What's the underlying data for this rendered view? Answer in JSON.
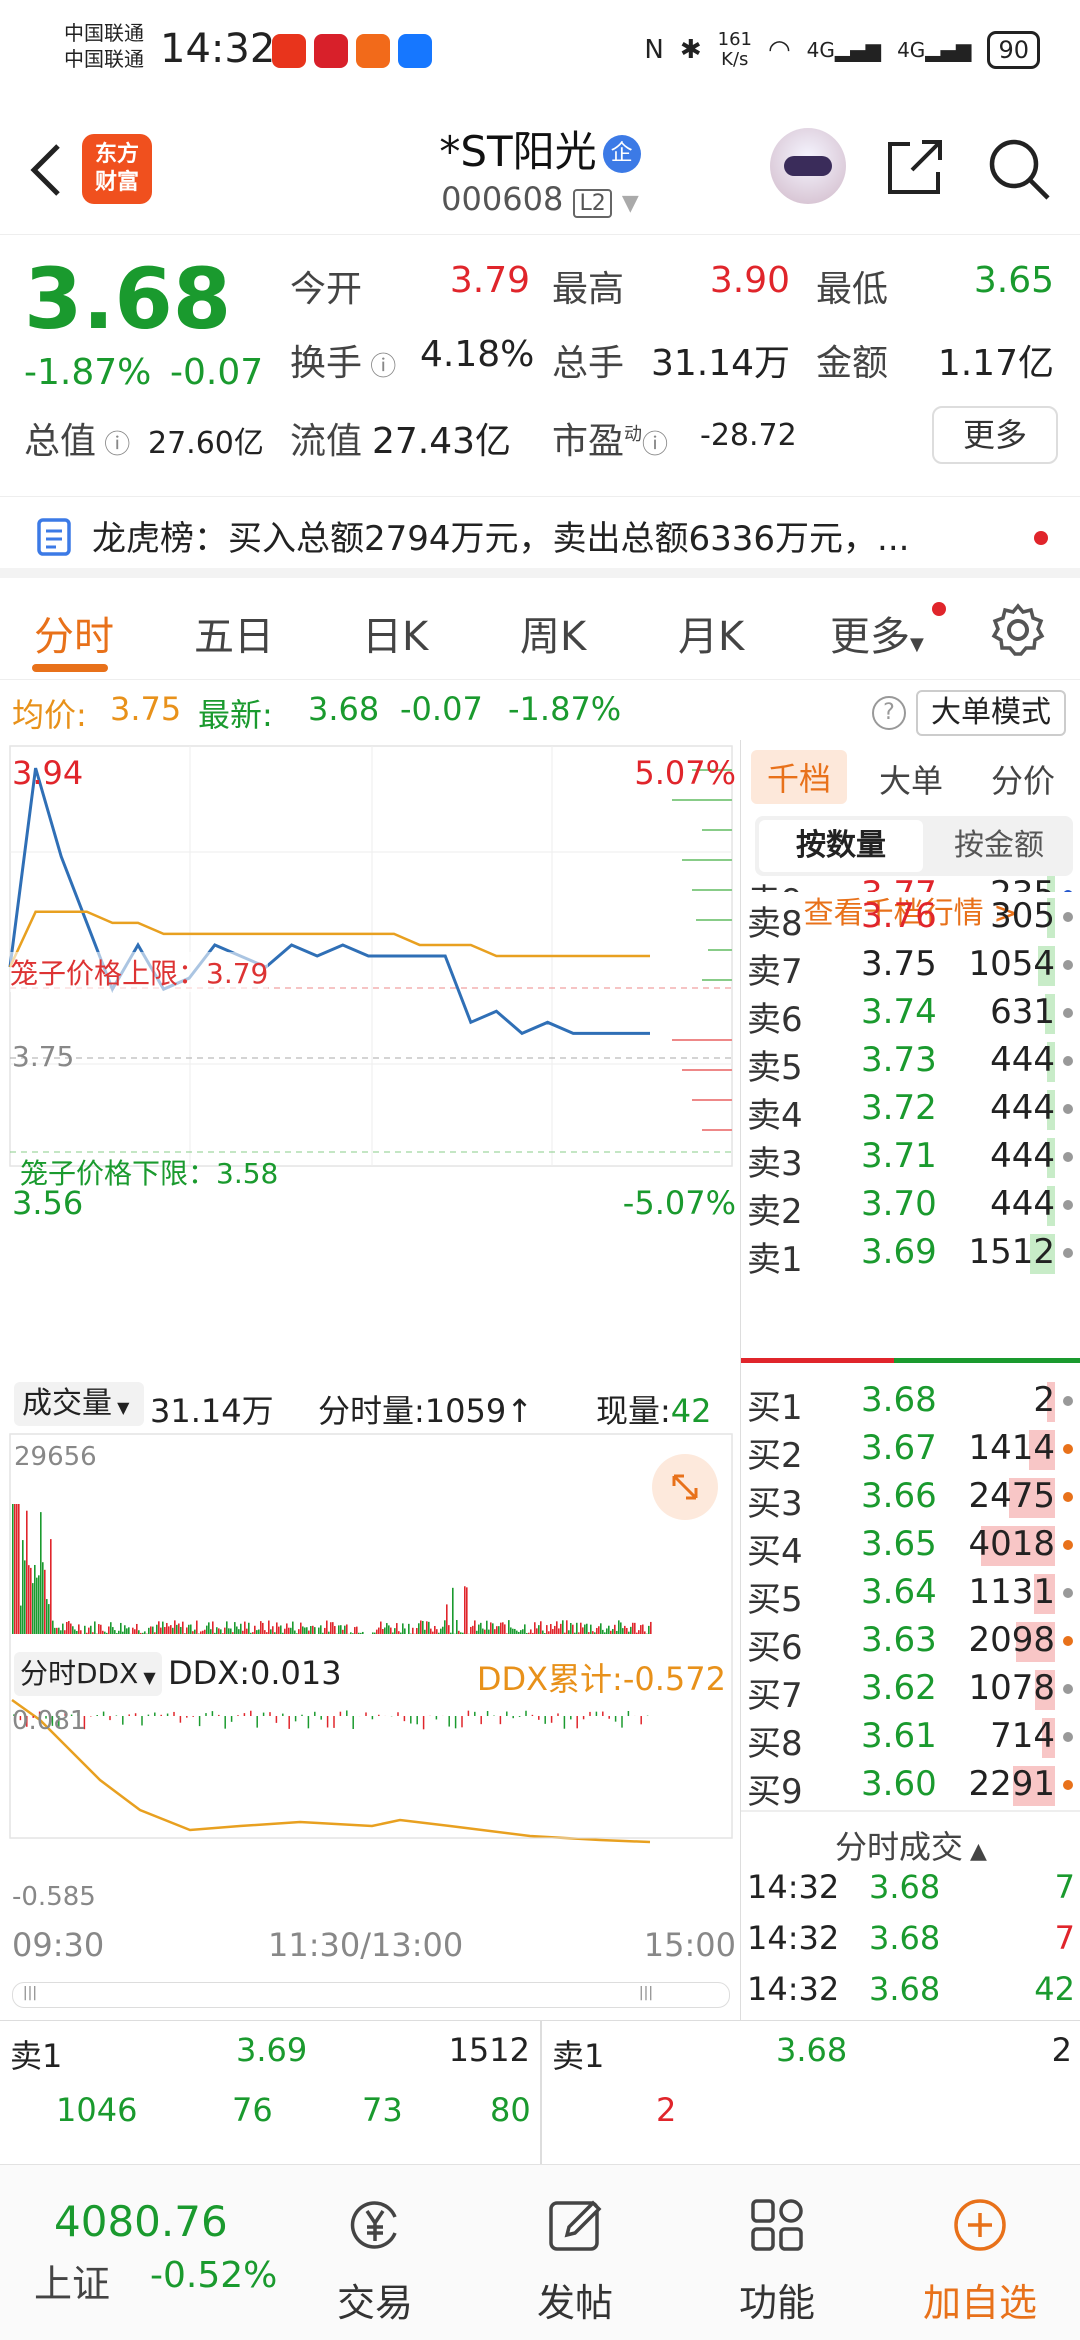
{
  "status": {
    "carrier1": "中国联通",
    "carrier2": "中国联通",
    "time": "14:32",
    "net_speed_top": "161",
    "net_speed_bottom": "K/s",
    "signal1": "4G",
    "signal2": "4G",
    "battery": "90"
  },
  "header": {
    "logo_line1": "东方",
    "logo_line2": "财富",
    "stock_name": "*ST阳光",
    "badge": "企",
    "code": "000608",
    "level": "L2"
  },
  "quote": {
    "price": "3.68",
    "change_pct": "-1.87%",
    "change": "-0.07",
    "open_label": "今开",
    "open": "3.79",
    "high_label": "最高",
    "high": "3.90",
    "low_label": "最低",
    "low": "3.65",
    "turnover_label": "换手",
    "turnover": "4.18%",
    "volume_label": "总手",
    "volume": "31.14万",
    "amount_label": "金额",
    "amount": "1.17亿",
    "mktcap_label": "总值",
    "mktcap": "27.60亿",
    "float_label": "流值",
    "float": "27.43亿",
    "pe_label": "市盈",
    "pe_sup": "动",
    "pe": "-28.72",
    "more": "更多"
  },
  "dragon": {
    "text": "龙虎榜：买入总额2794万元，卖出总额6336万元，..."
  },
  "tabs": [
    "分时",
    "五日",
    "日K",
    "周K",
    "月K",
    "更多"
  ],
  "infoline": {
    "avg_label": "均价:",
    "avg": "3.75",
    "latest_label": "最新:",
    "latest": "3.68",
    "chg": "-0.07",
    "pct": "-1.87%",
    "bigorder": "大单模式"
  },
  "chart": {
    "price_max": "3.94",
    "price_min": "3.56",
    "pct_max": "5.07%",
    "pct_min": "-5.07%",
    "avg_line_label": "3.75",
    "upper_limit": "笼子价格上限：3.79",
    "lower_limit": "笼子价格下限：3.58",
    "vol_label": "成交量",
    "vol_total": "31.14万",
    "vol_minute": "分时量:1059",
    "vol_now_label": "现量:",
    "vol_now": "42",
    "vol_max": "29656",
    "ddx_label": "分时DDX",
    "ddx": "DDX:0.013",
    "ddx_cum": "DDX累计:-0.572",
    "ddx_top": "0.081",
    "ddx_bottom": "-0.585",
    "time_start": "09:30",
    "time_mid": "11:30/13:00",
    "time_end": "15:00"
  },
  "chart_data": {
    "type": "line",
    "x": [
      "09:30",
      "09:33",
      "09:36",
      "09:40",
      "09:45",
      "09:50",
      "10:00",
      "10:10",
      "10:20",
      "10:30",
      "10:40",
      "10:50",
      "11:00",
      "11:10",
      "11:20",
      "11:30",
      "13:10",
      "13:20",
      "13:30",
      "13:40",
      "13:50",
      "14:00",
      "14:10",
      "14:20",
      "14:30",
      "14:32"
    ],
    "series": [
      {
        "name": "最新",
        "values": [
          3.74,
          3.92,
          3.84,
          3.78,
          3.72,
          3.76,
          3.72,
          3.73,
          3.76,
          3.75,
          3.74,
          3.76,
          3.75,
          3.76,
          3.75,
          3.75,
          3.75,
          3.75,
          3.69,
          3.7,
          3.68,
          3.69,
          3.68,
          3.68,
          3.68,
          3.68
        ]
      },
      {
        "name": "均价",
        "values": [
          3.74,
          3.79,
          3.79,
          3.79,
          3.78,
          3.78,
          3.77,
          3.77,
          3.77,
          3.77,
          3.77,
          3.77,
          3.77,
          3.77,
          3.77,
          3.77,
          3.76,
          3.76,
          3.76,
          3.75,
          3.75,
          3.75,
          3.75,
          3.75,
          3.75,
          3.75
        ]
      }
    ],
    "ylim": [
      3.56,
      3.94
    ]
  },
  "book": {
    "tabs": [
      "千档",
      "大单",
      "分价"
    ],
    "seg_on": "按数量",
    "seg_off": "按金额",
    "view": "查看千档行情 >",
    "asks": [
      {
        "label": "卖9",
        "price": "3.77",
        "qty": "235"
      },
      {
        "label": "卖8",
        "price": "3.76",
        "qty": "305"
      },
      {
        "label": "卖7",
        "price": "3.75",
        "qty": "1054"
      },
      {
        "label": "卖6",
        "price": "3.74",
        "qty": "631"
      },
      {
        "label": "卖5",
        "price": "3.73",
        "qty": "444"
      },
      {
        "label": "卖4",
        "price": "3.72",
        "qty": "444"
      },
      {
        "label": "卖3",
        "price": "3.71",
        "qty": "444"
      },
      {
        "label": "卖2",
        "price": "3.70",
        "qty": "444"
      },
      {
        "label": "卖1",
        "price": "3.69",
        "qty": "1512"
      }
    ],
    "bids": [
      {
        "label": "买1",
        "price": "3.68",
        "qty": "2"
      },
      {
        "label": "买2",
        "price": "3.67",
        "qty": "1414"
      },
      {
        "label": "买3",
        "price": "3.66",
        "qty": "2475"
      },
      {
        "label": "买4",
        "price": "3.65",
        "qty": "4018"
      },
      {
        "label": "买5",
        "price": "3.64",
        "qty": "1131"
      },
      {
        "label": "买6",
        "price": "3.63",
        "qty": "2098"
      },
      {
        "label": "买7",
        "price": "3.62",
        "qty": "1078"
      },
      {
        "label": "买8",
        "price": "3.61",
        "qty": "714"
      },
      {
        "label": "买9",
        "price": "3.60",
        "qty": "2291"
      }
    ],
    "ticks_title": "分时成交",
    "ticks": [
      {
        "t": "14:32",
        "p": "3.68",
        "v": "7"
      },
      {
        "t": "14:32",
        "p": "3.68",
        "v": "7"
      },
      {
        "t": "14:32",
        "p": "3.68",
        "v": "42"
      }
    ]
  },
  "strip": {
    "left_label": "卖1",
    "left_price": "3.69",
    "left_qty": "1512",
    "right_label": "卖1",
    "right_price": "3.68",
    "right_qty": "2",
    "row2": [
      "1046",
      "76",
      "73",
      "80"
    ],
    "row2_right": "2"
  },
  "nav": {
    "index_value": "4080.76",
    "index_name": "上证",
    "index_pct": "-0.52%",
    "items": [
      "交易",
      "发帖",
      "功能",
      "加自选"
    ]
  },
  "colors": {
    "up": "#e0252b",
    "down": "#1a9a2e",
    "accent": "#e8711a",
    "avg": "#e8a020",
    "price_line": "#2f6fb6"
  }
}
